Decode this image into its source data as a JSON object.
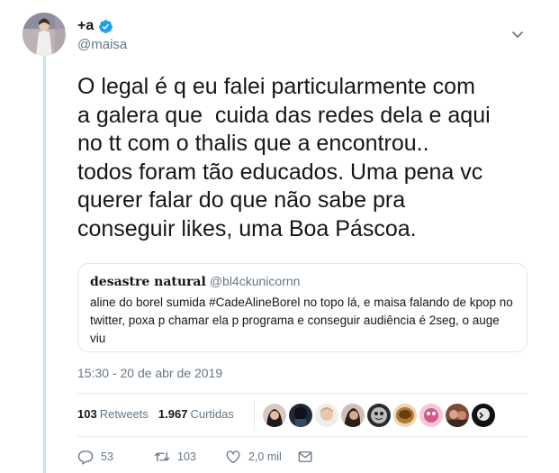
{
  "tweet": {
    "display_name": "+a",
    "handle": "@maisa",
    "text": "O legal é q eu falei particularmente com\na galera que  cuida das redes dela e aqui\nno tt com o thalis que a encontrou..\ntodos foram tão educados. Uma pena vc\nquerer falar do que não sabe pra\nconseguir likes, uma Boa Páscoa.",
    "timestamp": "15:30 - 20 de abr de 2019"
  },
  "quote": {
    "display_name": "desastre natural",
    "handle": "@bl4ckunicornn",
    "text": "aline do borel sumida #CadeAlineBorel no topo lá, e maisa falando de kpop no twitter, poxa p chamar ela p programa e conseguir audiência é 2seg, o auge viu"
  },
  "stats": {
    "retweets_count": "103",
    "retweets_label": "Retweets",
    "likes_count": "1.967",
    "likes_label": "Curtidas"
  },
  "actions": {
    "reply_count": "53",
    "retweet_count": "103",
    "like_count": "2,0 mil"
  },
  "icons": {
    "verified": "verified-badge-icon",
    "caret": "chevron-down-icon",
    "reply": "reply-icon",
    "retweet": "retweet-icon",
    "like": "heart-icon",
    "dm": "envelope-icon"
  },
  "colors": {
    "accent": "#1da1f2",
    "secondary_text": "#657786",
    "thread_line": "#c4e3f7",
    "border": "#e1e8ed"
  }
}
